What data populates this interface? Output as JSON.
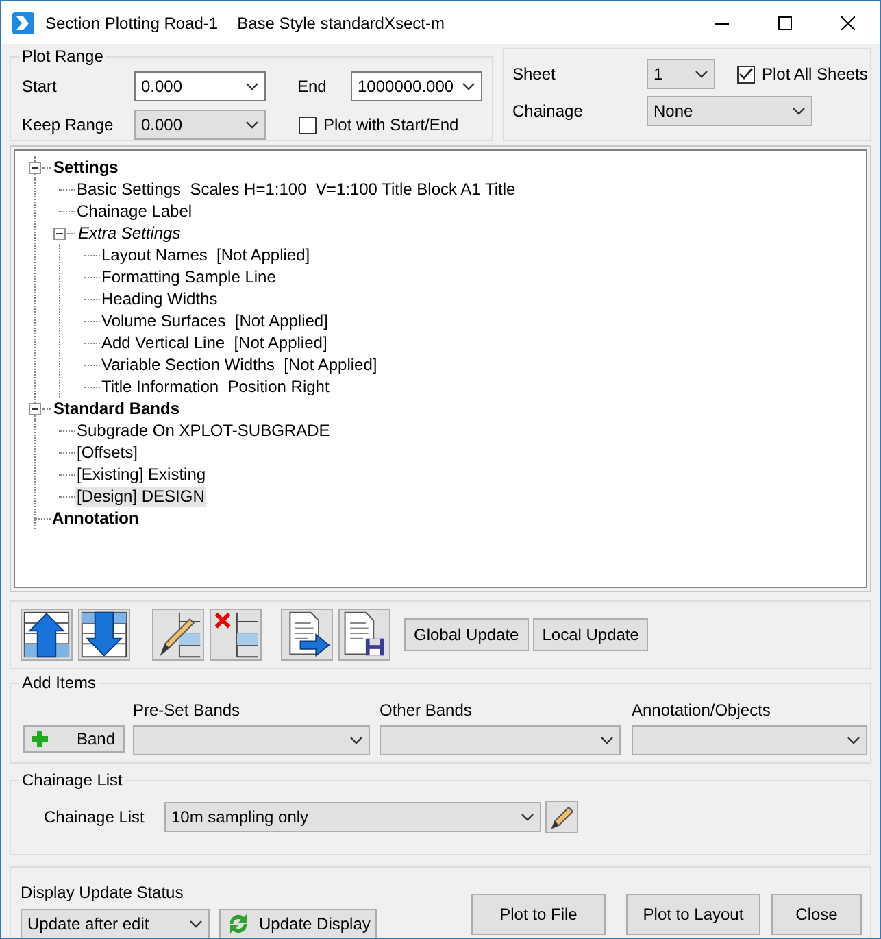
{
  "window": {
    "title": "Section Plotting Road-1",
    "subtitle": "Base Style standardXsect-m"
  },
  "plot_range": {
    "title": "Plot Range",
    "start": {
      "label": "Start",
      "value": "0.000",
      "editable": true
    },
    "end": {
      "label": "End",
      "value": "1000000.000",
      "editable": true
    },
    "keep_range": {
      "label": "Keep Range",
      "value": "0.000",
      "editable": false
    },
    "plot_with_start_end": {
      "label": "Plot with Start/End",
      "checked": false
    }
  },
  "sheet_panel": {
    "sheet": {
      "label": "Sheet",
      "value": "1",
      "editable": false
    },
    "plot_all_sheets": {
      "label": "Plot All Sheets",
      "checked": true
    },
    "chainage": {
      "label": "Chainage",
      "value": "None",
      "editable": false
    }
  },
  "tree": [
    {
      "label": "Settings",
      "kind": "group",
      "selected": false,
      "expanded": true,
      "children": [
        {
          "label": "Basic Settings  Scales H=1:100  V=1:100 Title Block A1 Title",
          "kind": "item",
          "selected": false
        },
        {
          "label": "Chainage Label",
          "kind": "item",
          "selected": false
        },
        {
          "label": "Extra Settings",
          "kind": "subgroup",
          "selected": false,
          "expanded": true,
          "children": [
            {
              "label": "Layout Names  [Not Applied]",
              "kind": "item",
              "selected": false
            },
            {
              "label": "Formatting Sample Line",
              "kind": "item",
              "selected": false
            },
            {
              "label": "Heading Widths",
              "kind": "item",
              "selected": false
            },
            {
              "label": "Volume Surfaces  [Not Applied]",
              "kind": "item",
              "selected": false
            },
            {
              "label": "Add Vertical Line  [Not Applied]",
              "kind": "item",
              "selected": false
            },
            {
              "label": "Variable Section Widths  [Not Applied]",
              "kind": "item",
              "selected": false
            },
            {
              "label": "Title Information  Position Right",
              "kind": "item",
              "selected": false
            }
          ]
        }
      ]
    },
    {
      "label": "Standard Bands",
      "kind": "group",
      "selected": false,
      "expanded": true,
      "children": [
        {
          "label": "Subgrade On XPLOT-SUBGRADE",
          "kind": "item",
          "selected": false
        },
        {
          "label": "[Offsets]",
          "kind": "item",
          "selected": false
        },
        {
          "label": "[Existing] Existing",
          "kind": "item",
          "selected": false
        },
        {
          "label": "[Design] DESIGN",
          "kind": "item",
          "selected": true
        }
      ]
    },
    {
      "label": "Annotation",
      "kind": "group",
      "selected": false
    }
  ],
  "toolbar": {
    "icon_buttons": [
      {
        "kind": "move-up"
      },
      {
        "kind": "move-down"
      },
      {
        "kind": "edit"
      },
      {
        "kind": "delete"
      },
      {
        "kind": "export"
      },
      {
        "kind": "save"
      }
    ],
    "buttons": [
      "Global Update",
      "Local Update"
    ]
  },
  "add_items": {
    "title": "Add Items",
    "band_button": "Band",
    "dropdowns": [
      {
        "label": "Pre-Set Bands"
      },
      {
        "label": "Other Bands"
      },
      {
        "label": "Annotation/Objects"
      }
    ]
  },
  "chainage_list": {
    "title": "Chainage List",
    "label": "Chainage List",
    "value": "10m sampling only"
  },
  "display_update": {
    "title": "Display Update Status",
    "value": "Update after edit",
    "button": "Update Display"
  },
  "buttons": [
    "Plot to File",
    "Plot to Layout",
    "Close"
  ]
}
